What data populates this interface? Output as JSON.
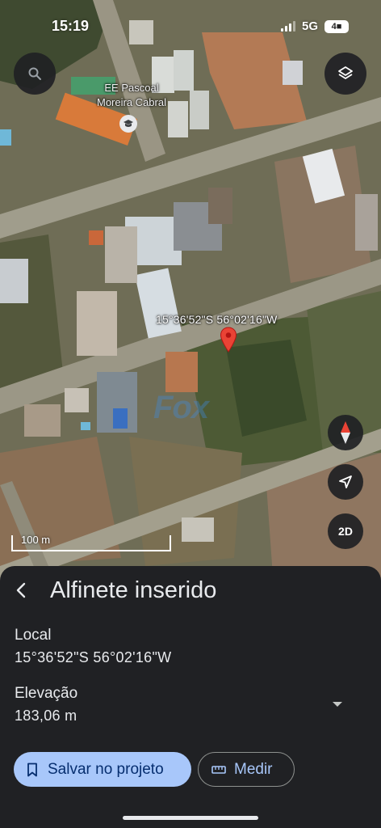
{
  "status_bar": {
    "time": "15:19",
    "network": "5G",
    "battery": "4■"
  },
  "map": {
    "place_label_line1": "EE Pascoal",
    "place_label_line2": "Moreira Cabral",
    "pin_coordinates": "15°36'52\"S 56°02'16\"W",
    "scale_label": "100 m",
    "watermark": "Fox",
    "view_mode": "2D",
    "icons": {
      "search": "search-icon",
      "layers": "layers-icon",
      "compass": "compass-icon",
      "locate": "navigation-arrow-icon",
      "pin": "location-pin-icon",
      "school": "school-icon"
    }
  },
  "sheet": {
    "title": "Alfinete inserido",
    "location_label": "Local",
    "location_value": "15°36'52\"S 56°02'16\"W",
    "elevation_label": "Elevação",
    "elevation_value": "183,06 m",
    "save_label": "Salvar no projeto",
    "measure_label": "Medir"
  },
  "colors": {
    "sheet_bg": "#202124",
    "primary_button": "#a8c7fa",
    "primary_button_text": "#062e6f",
    "pin": "#ea4335"
  }
}
